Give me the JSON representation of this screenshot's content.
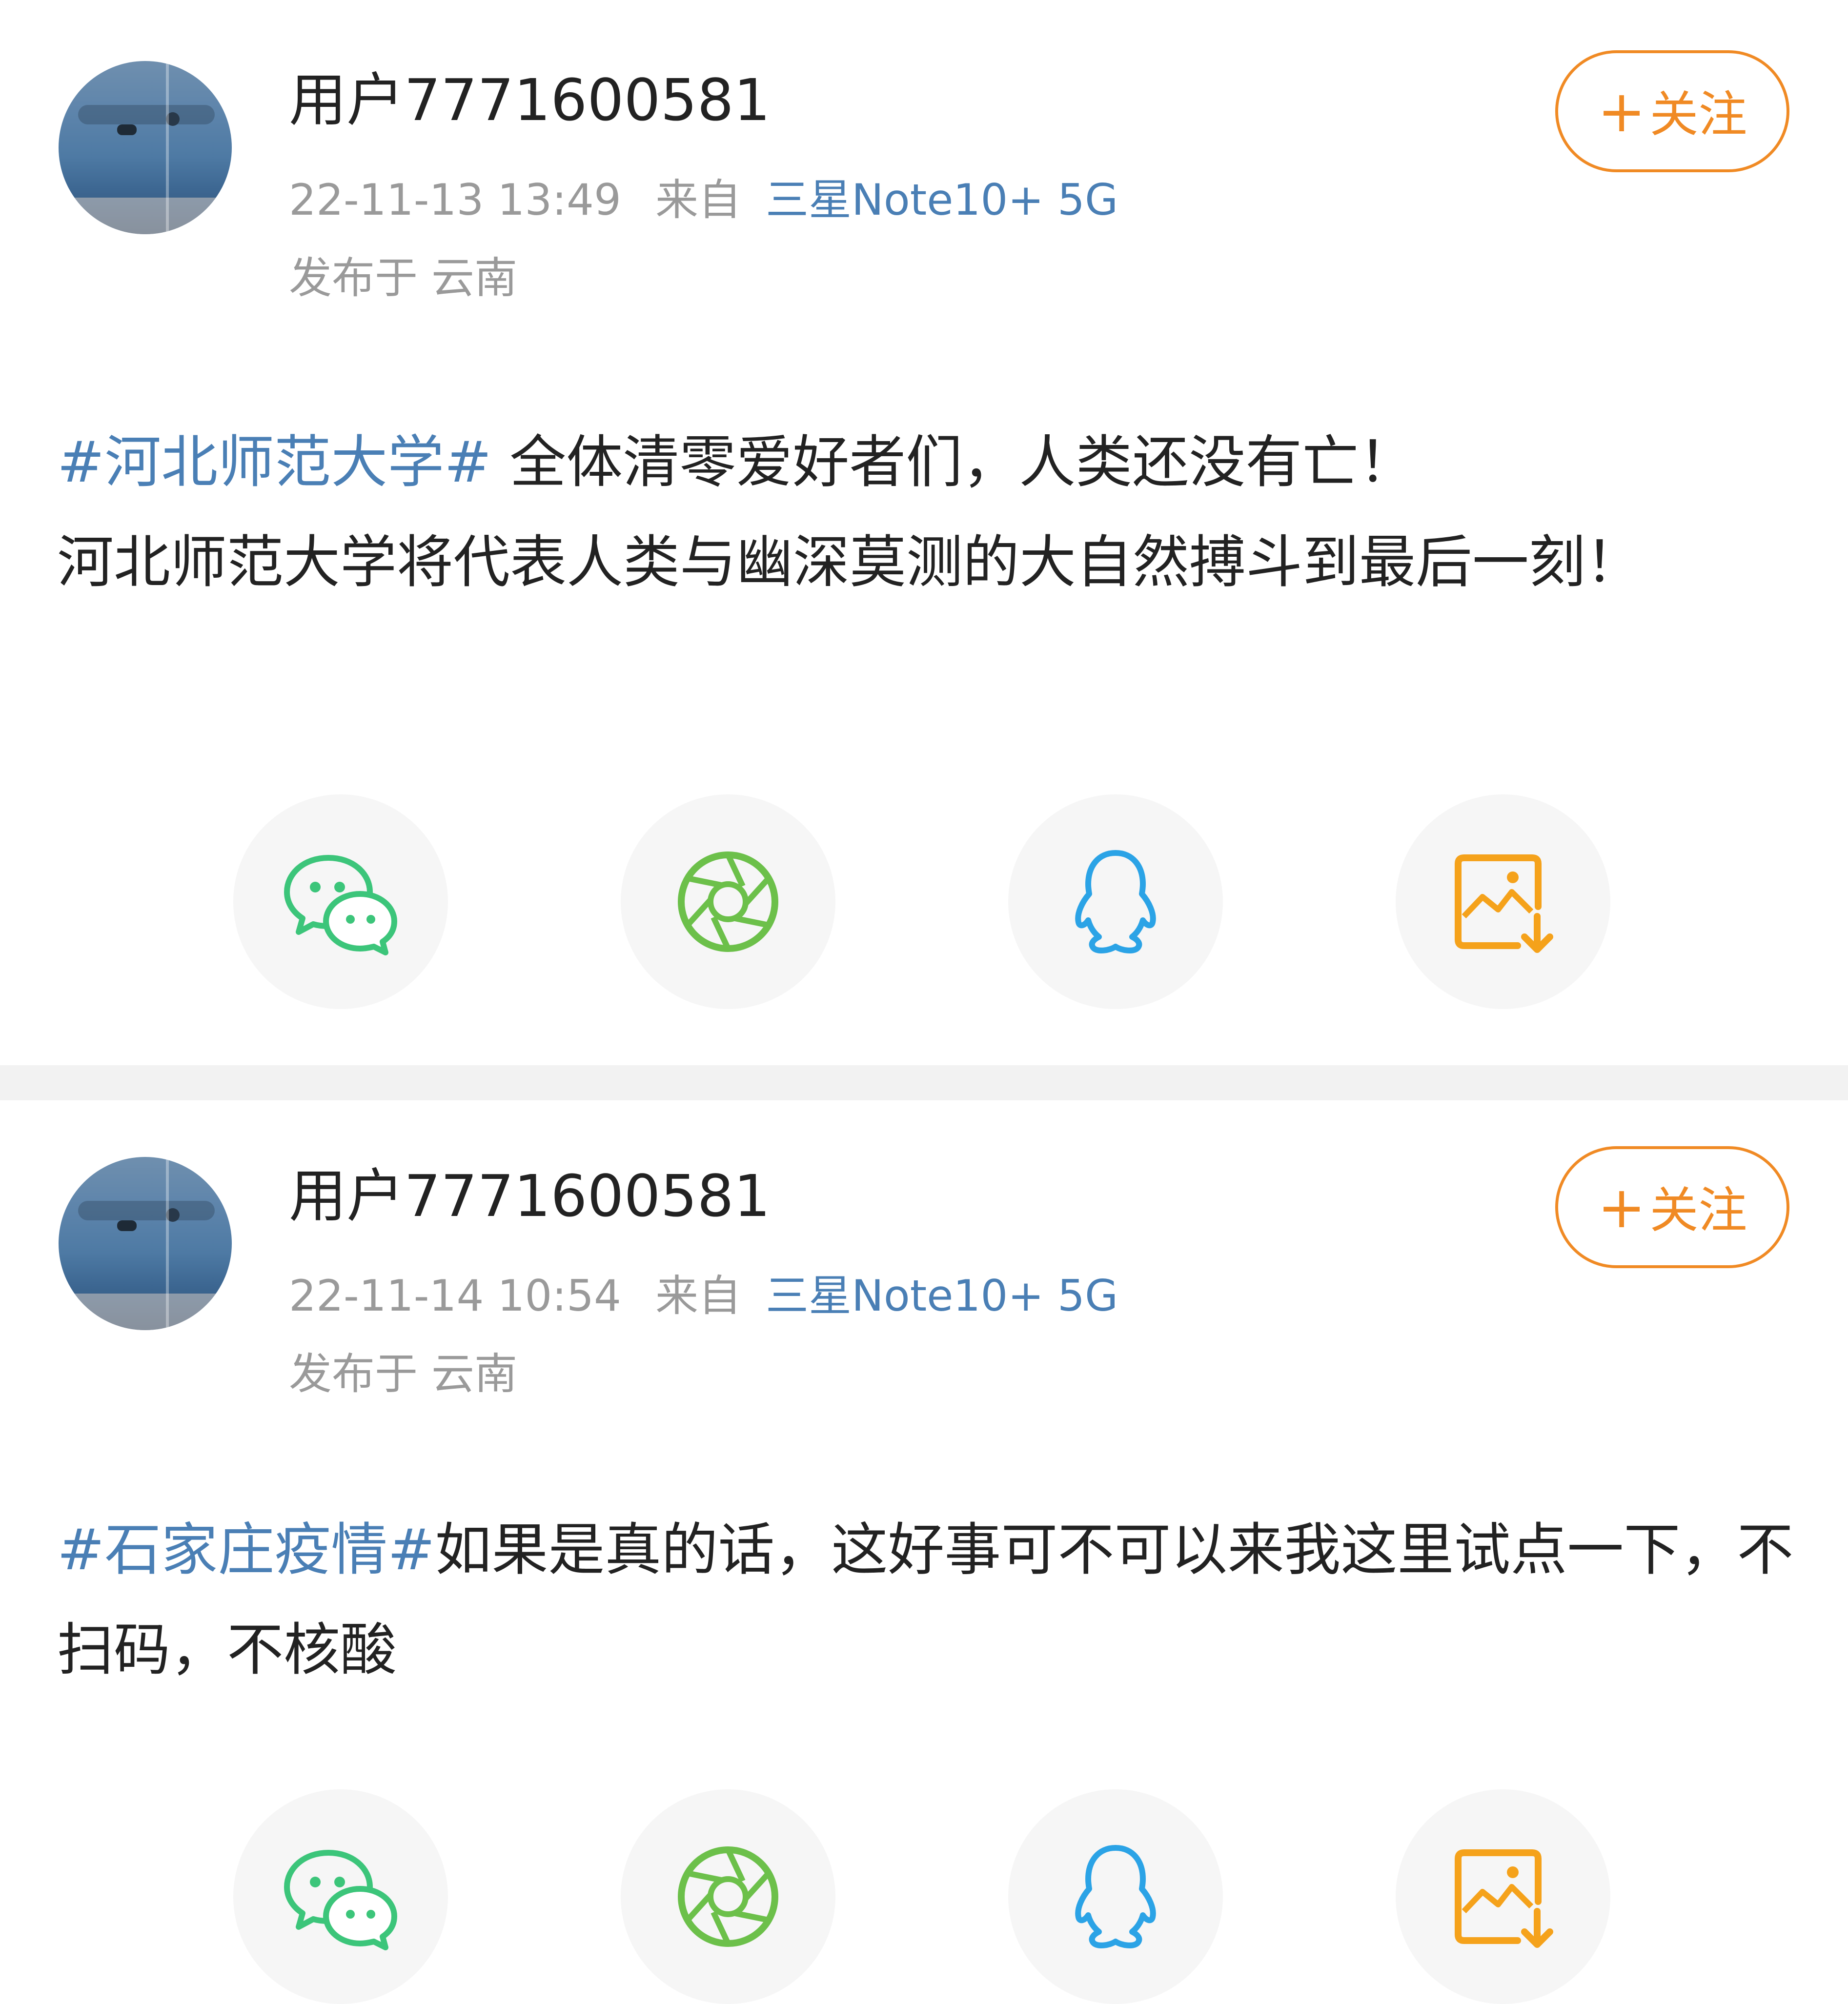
{
  "posts": [
    {
      "username": "用户7771600581",
      "timestamp": "22-11-13 13:49",
      "from_label": "来自",
      "device": "三星Note10+ 5G",
      "location": "发布于 云南",
      "follow_plus": "+",
      "follow_label": "关注",
      "topic": "#河北师范大学#",
      "text_after_topic": " 全体清零爱好者们，人类还没有亡！",
      "text_line2": "河北师范大学将代表人类与幽深莫测的大自然搏斗到最后一刻！"
    },
    {
      "username": "用户7771600581",
      "timestamp": "22-11-14 10:54",
      "from_label": "来自",
      "device": "三星Note10+ 5G",
      "location": "发布于 云南",
      "follow_plus": "+",
      "follow_label": "关注",
      "topic": "#石家庄疫情#",
      "text_after_topic": "如果是真的话，这好事可不可以来我这里试点一下，不扫码，不核酸",
      "text_line2": ""
    }
  ],
  "share_icons": [
    "wechat-icon",
    "moments-icon",
    "qq-icon",
    "save-image-icon"
  ],
  "colors": {
    "accent_orange": "#f08a24",
    "link_blue": "#4a7fb5",
    "meta_gray": "#9a9a9a",
    "wechat_green": "#3cc57a",
    "moments_green": "#6cc04a",
    "qq_blue": "#2ba3e6",
    "save_orange": "#f5a21b"
  }
}
